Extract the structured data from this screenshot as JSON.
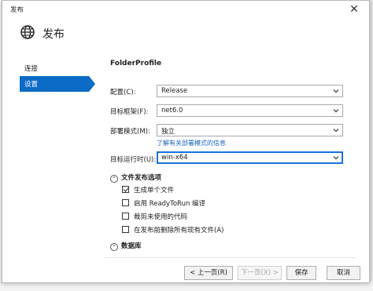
{
  "window": {
    "title": "发布",
    "close_glyph": "✕"
  },
  "header": {
    "title": "发布",
    "icon": "globe-publish-icon"
  },
  "sidebar": {
    "items": [
      {
        "label": "连接",
        "active": false
      },
      {
        "label": "设置",
        "active": true
      }
    ]
  },
  "profile": {
    "name": "FolderProfile"
  },
  "fields": {
    "configuration": {
      "label": "配置(C):",
      "value": "Release"
    },
    "target_framework": {
      "label": "目标框架(F):",
      "value": "net6.0"
    },
    "deployment_mode": {
      "label": "部署模式(M):",
      "value": "独立"
    },
    "deployment_link": "了解有关部署模式的信息",
    "target_runtime": {
      "label": "目标运行时(U):",
      "value": "win-x64"
    }
  },
  "file_publish_options": {
    "title": "文件发布选项",
    "options": [
      {
        "label": "生成单个文件",
        "checked": true
      },
      {
        "label": "启用 ReadyToRun 编译",
        "checked": false
      },
      {
        "label": "裁剪未使用的代码",
        "checked": false
      },
      {
        "label": "在发布前删除所有现有文件(A)",
        "checked": false
      }
    ]
  },
  "database": {
    "title": "数据库"
  },
  "buttons": {
    "prev": "< 上一页(R)",
    "next": "下一页(X) >",
    "save": "保存",
    "cancel": "取消"
  },
  "colors": {
    "accent": "#0b6bc6",
    "link": "#1665c1",
    "focus": "#1a73d9"
  }
}
